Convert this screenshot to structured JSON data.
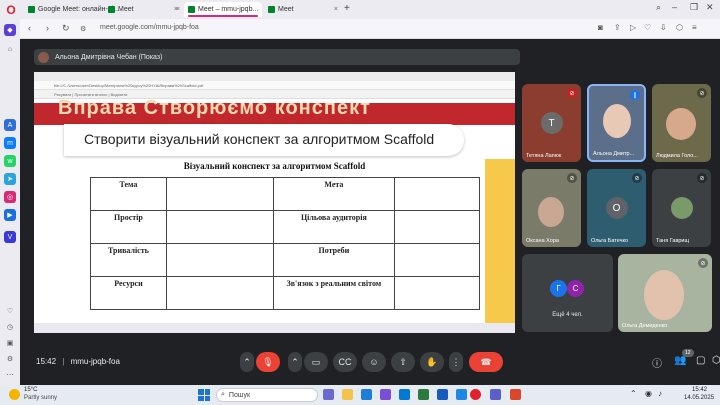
{
  "browser": {
    "tabs": [
      {
        "label": "Google Meet: онлайн-ві..."
      },
      {
        "label": "Meet"
      },
      {
        "label": "Meet – mmu-jpqb..."
      },
      {
        "label": "Meet"
      }
    ],
    "url": "meet.google.com/mmu-jpqb-foa"
  },
  "meet": {
    "presenter_label": "Альона Дмитрівна Чебан (Показ)",
    "meeting_code": "mmu-jpqb-foa",
    "time": "15:42",
    "participants_count": "12"
  },
  "slide": {
    "banner_text": "Вправа  Створюємо конспект",
    "title": "Створити візуальний конспект за алгоритмом Scaffold",
    "table_title": "Візуальний конспект за алгоритмом Scaffold",
    "inner_url": "file:///C:/Users/user/Desktop/Матеріали%20курсу%20НУШ/Вправа%20Scaffold.pdf",
    "inner_tools": "Рисувати   |   Прочитати вголос   |   Виділити",
    "table": [
      [
        "Тема",
        "",
        "Мета",
        ""
      ],
      [
        "Простір",
        "",
        "Цільова аудиторія",
        ""
      ],
      [
        "Тривалість",
        "",
        "Потреби",
        ""
      ],
      [
        "Ресурси",
        "",
        "Зв'язок з реальним світом",
        ""
      ]
    ]
  },
  "participants": [
    {
      "name": "Тетяна Лапюк",
      "initial": "Т",
      "color": "#8b3e2f"
    },
    {
      "name": "Альона Дмитр...",
      "initial": "",
      "color": "#5b6e8a"
    },
    {
      "name": "Людмила Голо...",
      "initial": "",
      "color": "#6d6a4b"
    },
    {
      "name": "Оксана Хора",
      "initial": "",
      "color": "#7b7b6a"
    },
    {
      "name": "Ольга Батечко",
      "initial": "О",
      "color": "#2f5d70"
    },
    {
      "name": "Таня Гаврищ",
      "initial": "",
      "color": "#3c4043"
    }
  ],
  "more_tile": {
    "initials": [
      "Г",
      "С"
    ],
    "label": "Ещё 4 чел."
  },
  "big_tile": {
    "name": "Ольга Демиденко"
  },
  "taskbar": {
    "temperature": "15°C",
    "weather": "Partly sunny",
    "search_placeholder": "Пошук",
    "clock_time": "15:42",
    "clock_date": "14.05.2025"
  }
}
